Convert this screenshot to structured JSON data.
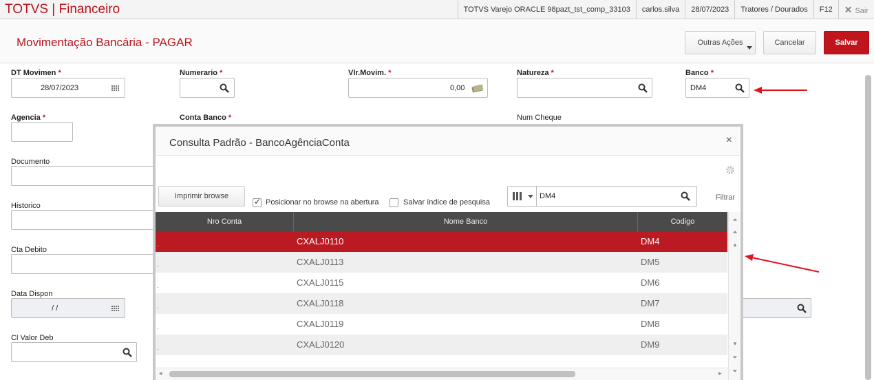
{
  "topbar": {
    "brand": "TOTVS | Financeiro",
    "environment": "TOTVS Varejo ORACLE 98pazt_tst_comp_33103",
    "user": "carlos.silva",
    "date": "28/07/2023",
    "branch": "Tratores / Dourados",
    "shortcut": "F12",
    "exit_label": "Sair"
  },
  "header": {
    "title": "Movimentação Bancária - PAGAR",
    "more_actions": "Outras Ações",
    "cancel": "Cancelar",
    "save": "Salvar"
  },
  "form": {
    "dt_movimen": {
      "label": "DT Movimen",
      "required": "*",
      "value": "28/07/2023"
    },
    "numerario": {
      "label": "Numerario",
      "required": "*",
      "value": ""
    },
    "vlr_movim": {
      "label": "Vlr.Movim.",
      "required": "*",
      "value": "0,00"
    },
    "natureza": {
      "label": "Natureza",
      "required": "*",
      "value": ""
    },
    "banco": {
      "label": "Banco",
      "required": "*",
      "value": "DM4"
    },
    "agencia": {
      "label": "Agencia",
      "required": "*",
      "value": ""
    },
    "conta_banco": {
      "label": "Conta Banco",
      "required": "*"
    },
    "num_cheque": {
      "label": "Num Cheque"
    },
    "documento": {
      "label": "Documento"
    },
    "historico": {
      "label": "Historico"
    },
    "cta_debito": {
      "label": "Cta Debito"
    },
    "data_dispon": {
      "label": "Data Dispon",
      "value": " / /"
    },
    "cl_valor_deb": {
      "label": "Cl Valor Deb"
    }
  },
  "modal": {
    "title": "Consulta Padrão - BancoAgênciaConta",
    "close": "×",
    "print_button": "Imprimir browse",
    "position_check_label": "Posicionar no browse na abertura",
    "position_checked": true,
    "save_index_label": "Salvar índice de pesquisa",
    "save_index_checked": false,
    "search_value": "DM4",
    "filter_label": "Filtrar",
    "columns": [
      "Nro Conta",
      "Nome Banco",
      "Codigo"
    ],
    "rows": [
      {
        "nro": ".",
        "nome": "CXALJ0110",
        "codigo": "DM4",
        "selected": true
      },
      {
        "nro": ".",
        "nome": "CXALJ0113",
        "codigo": "DM5",
        "selected": false
      },
      {
        "nro": ".",
        "nome": "CXALJ0115",
        "codigo": "DM6",
        "selected": false
      },
      {
        "nro": ".",
        "nome": "CXALJ0118",
        "codigo": "DM7",
        "selected": false
      },
      {
        "nro": ".",
        "nome": "CXALJ0119",
        "codigo": "DM8",
        "selected": false
      },
      {
        "nro": ".",
        "nome": "CXALJ0120",
        "codigo": "DM9",
        "selected": false
      }
    ]
  },
  "colors": {
    "brand_red": "#b9141c",
    "selected_row": "#bb1a22",
    "header_grid": "#4a4a4a"
  },
  "icons": {
    "lookup": "magnifier-icon",
    "date": "calendar-icon",
    "money": "money-icon",
    "settings": "gear-icon"
  }
}
